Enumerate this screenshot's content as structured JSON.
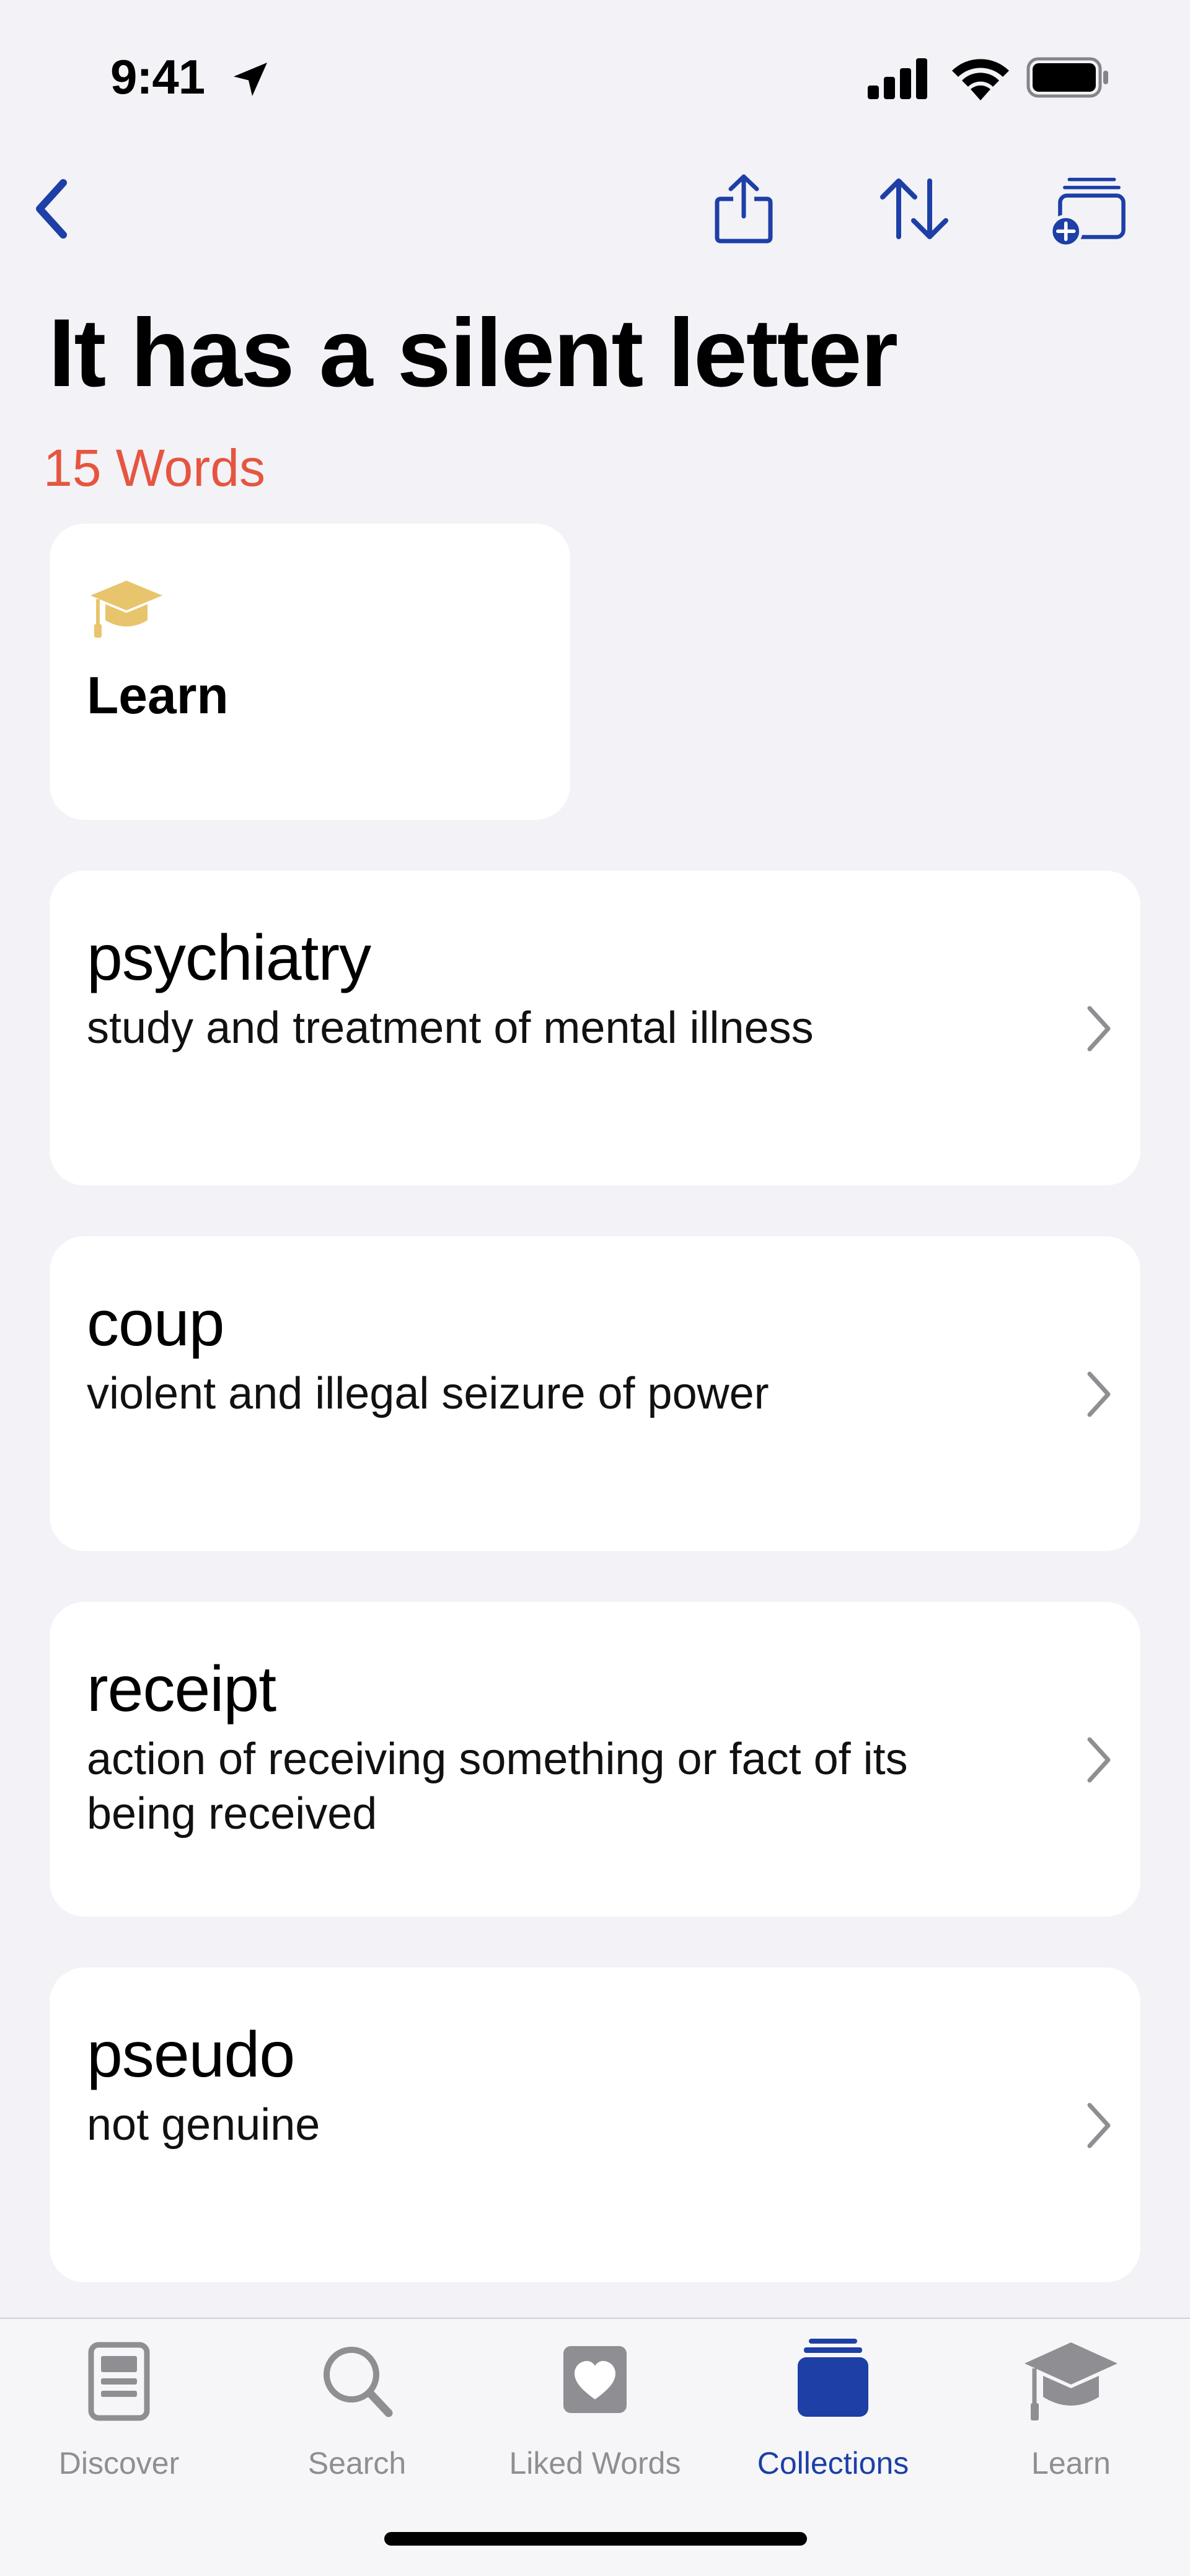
{
  "status_bar": {
    "time": "9:41"
  },
  "header": {
    "title": "It has a silent letter",
    "word_count": "15 Words"
  },
  "learn_card": {
    "label": "Learn"
  },
  "words": [
    {
      "word": "psychiatry",
      "definition": "study and treatment of mental illness"
    },
    {
      "word": "coup",
      "definition": "violent and illegal seizure of power"
    },
    {
      "word": "receipt",
      "definition": "action of receiving something or fact of its being received"
    },
    {
      "word": "pseudo",
      "definition": "not genuine"
    }
  ],
  "tabs": [
    {
      "label": "Discover",
      "icon": "discover-icon"
    },
    {
      "label": "Search",
      "icon": "search-icon"
    },
    {
      "label": "Liked Words",
      "icon": "heart-icon"
    },
    {
      "label": "Collections",
      "icon": "collections-icon",
      "active": true
    },
    {
      "label": "Learn",
      "icon": "graduation-cap-icon"
    }
  ],
  "colors": {
    "accent": "#1d3fa6",
    "count_red": "#e5553f",
    "cap_gold": "#e8c46c",
    "background": "#f2f2f7"
  }
}
